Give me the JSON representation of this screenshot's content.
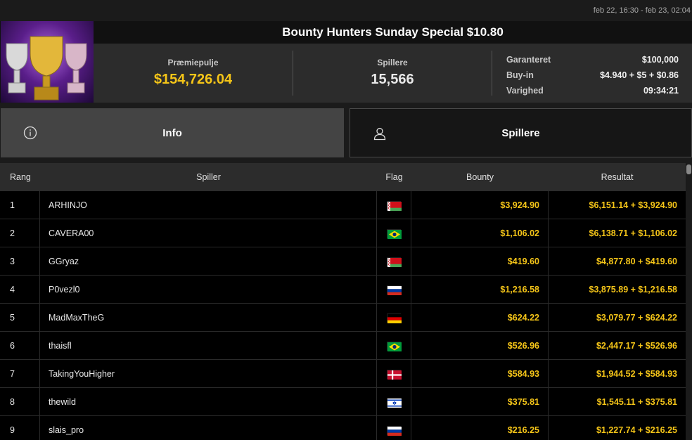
{
  "date_range": "feb 22, 16:30 - feb 23, 02:04",
  "tournament": {
    "title": "Bounty Hunters Sunday Special $10.80",
    "prize_pool_label": "Præmiepulje",
    "prize_pool": "$154,726.04",
    "players_label": "Spillere",
    "players": "15,566",
    "details": [
      {
        "key": "Garanteret",
        "value": "$100,000"
      },
      {
        "key": "Buy-in",
        "value": "$4.940 + $5 + $0.86"
      },
      {
        "key": "Varighed",
        "value": "09:34:21"
      }
    ]
  },
  "tabs": [
    {
      "label": "Info",
      "icon": "info-icon",
      "active": true
    },
    {
      "label": "Spillere",
      "icon": "user-icon",
      "active": false
    }
  ],
  "table": {
    "headers": [
      "Rang",
      "Spiller",
      "Flag",
      "Bounty",
      "Resultat"
    ],
    "rows": [
      {
        "rank": "1",
        "player": "ARHINJO",
        "flag": "belarus",
        "bounty": "$3,924.90",
        "result": "$6,151.14 + $3,924.90"
      },
      {
        "rank": "2",
        "player": "CAVERA00",
        "flag": "brazil",
        "bounty": "$1,106.02",
        "result": "$6,138.71 + $1,106.02"
      },
      {
        "rank": "3",
        "player": "GGryaz",
        "flag": "belarus",
        "bounty": "$419.60",
        "result": "$4,877.80 + $419.60"
      },
      {
        "rank": "4",
        "player": "P0vezl0",
        "flag": "russia",
        "bounty": "$1,216.58",
        "result": "$3,875.89 + $1,216.58"
      },
      {
        "rank": "5",
        "player": "MadMaxTheG",
        "flag": "germany",
        "bounty": "$624.22",
        "result": "$3,079.77 + $624.22"
      },
      {
        "rank": "6",
        "player": "thaisfl",
        "flag": "brazil",
        "bounty": "$526.96",
        "result": "$2,447.17 + $526.96"
      },
      {
        "rank": "7",
        "player": "TakingYouHigher",
        "flag": "denmark",
        "bounty": "$584.93",
        "result": "$1,944.52 + $584.93"
      },
      {
        "rank": "8",
        "player": "thewild",
        "flag": "israel",
        "bounty": "$375.81",
        "result": "$1,545.11 + $375.81"
      },
      {
        "rank": "9",
        "player": "slais_pro",
        "flag": "russia",
        "bounty": "$216.25",
        "result": "$1,227.74 + $216.25"
      }
    ]
  },
  "colors": {
    "gold": "#f5c518",
    "active_tab": "#444444"
  }
}
